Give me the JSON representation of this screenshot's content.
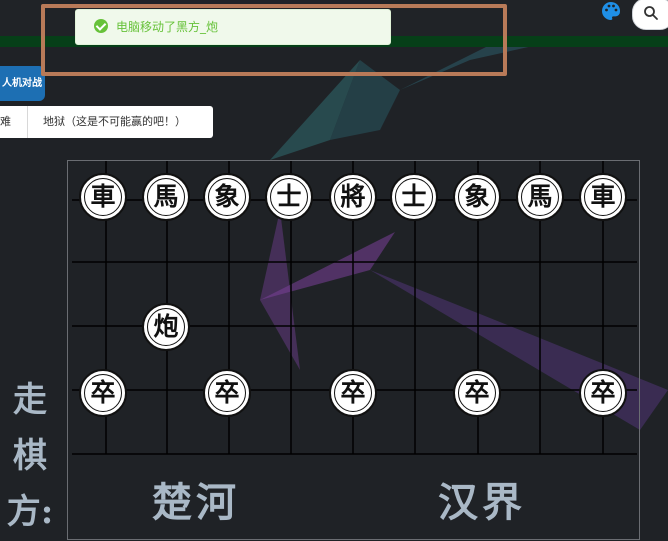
{
  "toast": {
    "message": "电脑移动了黑方_炮",
    "type": "success"
  },
  "header": {
    "mode_tab": "人机对战",
    "palette_icon": "palette-icon",
    "search_icon": "search-icon"
  },
  "difficulty": {
    "options": [
      "难",
      "地狱（这是不可能赢的吧！）"
    ]
  },
  "board": {
    "river_left": "楚河",
    "river_right": "汉界",
    "turn_label_chars": [
      "走",
      "棋",
      "方:"
    ],
    "back_row": [
      "車",
      "馬",
      "象",
      "士",
      "將",
      "士",
      "象",
      "馬",
      "車"
    ],
    "cannon": "炮",
    "soldier": "卒",
    "pieces": [
      {
        "char": "車",
        "file": 0,
        "rank": 0
      },
      {
        "char": "馬",
        "file": 1,
        "rank": 0
      },
      {
        "char": "象",
        "file": 2,
        "rank": 0
      },
      {
        "char": "士",
        "file": 3,
        "rank": 0
      },
      {
        "char": "將",
        "file": 4,
        "rank": 0
      },
      {
        "char": "士",
        "file": 5,
        "rank": 0
      },
      {
        "char": "象",
        "file": 6,
        "rank": 0
      },
      {
        "char": "馬",
        "file": 7,
        "rank": 0
      },
      {
        "char": "車",
        "file": 8,
        "rank": 0
      },
      {
        "char": "炮",
        "file": 1,
        "rank": 2
      },
      {
        "char": "卒",
        "file": 0,
        "rank": 3
      },
      {
        "char": "卒",
        "file": 2,
        "rank": 3
      },
      {
        "char": "卒",
        "file": 4,
        "rank": 3
      },
      {
        "char": "卒",
        "file": 6,
        "rank": 3
      },
      {
        "char": "卒",
        "file": 8,
        "rank": 3
      }
    ]
  },
  "colors": {
    "accent": "#1d6fb3",
    "success": "#67c23a",
    "highlight": "#b87a58"
  }
}
